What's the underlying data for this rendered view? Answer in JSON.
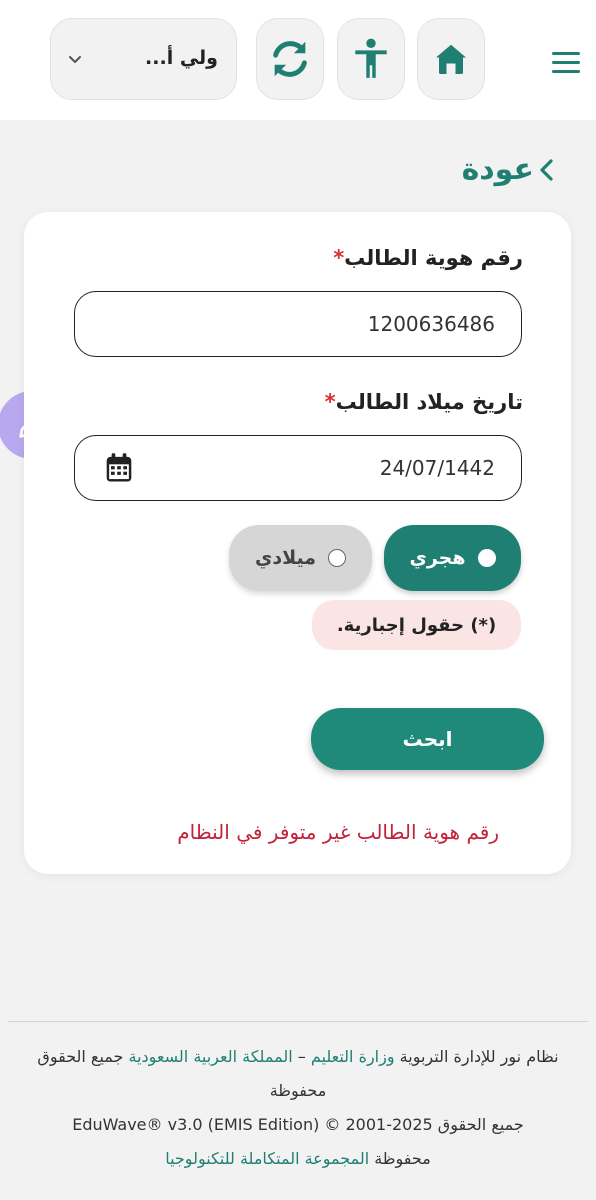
{
  "header": {
    "role_label": "ولي أ...",
    "icons": {
      "menu": "menu-icon",
      "home": "home-icon",
      "accessibility": "accessibility-icon",
      "sync": "sync-icon",
      "dropdown": "chevron-down-icon"
    }
  },
  "nav": {
    "back_label": "عودة"
  },
  "form": {
    "id_label": "رقم هوية الطالب",
    "id_value": "1200636486",
    "dob_label": "تاريخ ميلاد الطالب",
    "dob_value": "24/07/1442",
    "required_marker": "*",
    "calendar_options": {
      "hijri": "هجري",
      "gregorian": "ميلادي",
      "selected": "hijri"
    },
    "required_note": "(*) حقول إجبارية.",
    "search_button": "ابحث",
    "error_message": "رقم هوية الطالب غير متوفر في النظام"
  },
  "footer": {
    "line1_prefix": "نظام نور للإدارة التربوية ",
    "line1_ministry": "وزارة التعليم",
    "line1_sep": " – ",
    "line1_country": "المملكة العربية السعودية",
    "line1_suffix": " جميع الحقوق محفوظة",
    "line2": "جميع الحقوق EduWave® v3.0 (EMIS Edition) © 2001-2025",
    "line3_prefix": "محفوظة ",
    "line3_company": "المجموعة المتكاملة للتكنولوجيا"
  },
  "colors": {
    "primary": "#1f7f72",
    "error": "#c2233a",
    "required": "#d93030",
    "note_bg": "#fbe4e4",
    "fab": "#b8a8ef"
  }
}
